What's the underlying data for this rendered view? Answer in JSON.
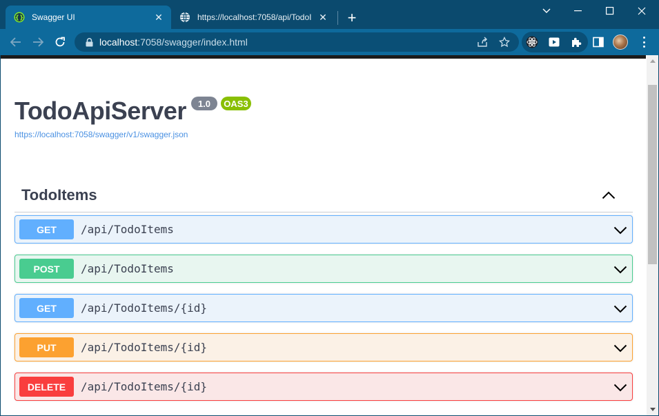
{
  "browser": {
    "tabs": [
      {
        "title": "Swagger UI",
        "close": "✕"
      },
      {
        "title": "https://localhost:7058/api/TodoI",
        "close": "✕"
      }
    ],
    "new_tab": "+",
    "address": {
      "host": "localhost",
      "rest": ":7058/swagger/index.html"
    },
    "theme_color": "#0b4a6e"
  },
  "page": {
    "title": "TodoApiServer",
    "version_badge": "1.0",
    "oas_badge": "OAS3",
    "spec_url": "https://localhost:7058/swagger/v1/swagger.json",
    "tag": {
      "name": "TodoItems",
      "expanded": true
    },
    "operations": [
      {
        "method": "GET",
        "path": "/api/TodoItems",
        "color": "#61affe"
      },
      {
        "method": "POST",
        "path": "/api/TodoItems",
        "color": "#49cc90"
      },
      {
        "method": "GET",
        "path": "/api/TodoItems/{id}",
        "color": "#61affe"
      },
      {
        "method": "PUT",
        "path": "/api/TodoItems/{id}",
        "color": "#fca130"
      },
      {
        "method": "DELETE",
        "path": "/api/TodoItems/{id}",
        "color": "#f93e3e"
      }
    ]
  }
}
